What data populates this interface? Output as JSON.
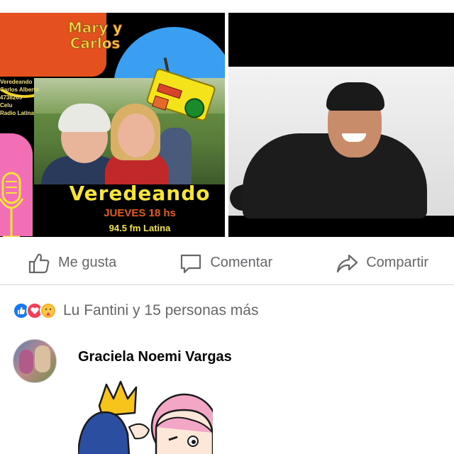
{
  "post": {
    "left_image": {
      "title_line1": "Mary y",
      "title_line2": "Carlos",
      "station_text": "Veredeando\nCarlos Alberto\n4738265\nCelu\nRadio Latina",
      "show_title": "Veredeando",
      "show_day": "JUEVES 18 hs",
      "show_freq": "94.5 fm Latina"
    }
  },
  "actions": {
    "like_label": "Me gusta",
    "comment_label": "Comentar",
    "share_label": "Compartir"
  },
  "reactions": {
    "icons": [
      "like-reaction-icon",
      "love-reaction-icon",
      "care-reaction-icon"
    ],
    "summary": "Lu Fantini y 15 personas más"
  },
  "comment": {
    "author": "Graciela Noemi Vargas"
  },
  "colors": {
    "like": "#1877f2",
    "love": "#f33e58",
    "care": "#f7b125",
    "muted_text": "#65676b"
  }
}
